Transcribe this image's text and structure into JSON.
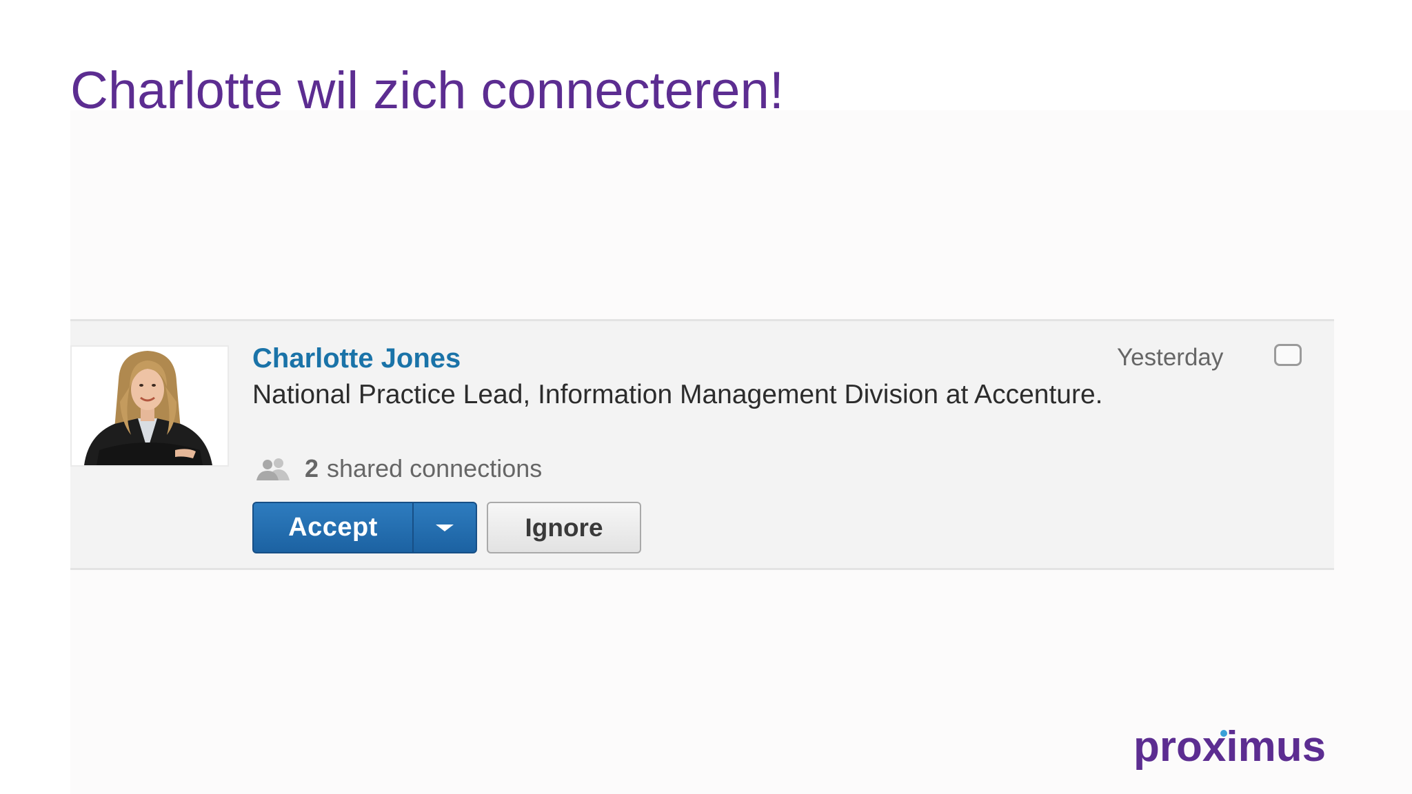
{
  "slide": {
    "title": "Charlotte wil zich connecteren!"
  },
  "invitation": {
    "name": "Charlotte Jones",
    "timestamp": "Yesterday",
    "headline": "National Practice Lead, Information Management Division at Accenture.",
    "shared_count": "2",
    "shared_label": "shared connections",
    "accept_label": "Accept",
    "ignore_label": "Ignore",
    "checked": false,
    "icons": [
      "avatar-photo",
      "people-icon",
      "chevron-down-icon"
    ]
  },
  "brand": {
    "logo_text": "proximus",
    "colors": {
      "title": "#5c2d91",
      "name_link": "#1a73a8",
      "accept_button": "#1c62a2",
      "logo": "#5c2d91",
      "logo_accent": "#3aa0d8"
    }
  }
}
